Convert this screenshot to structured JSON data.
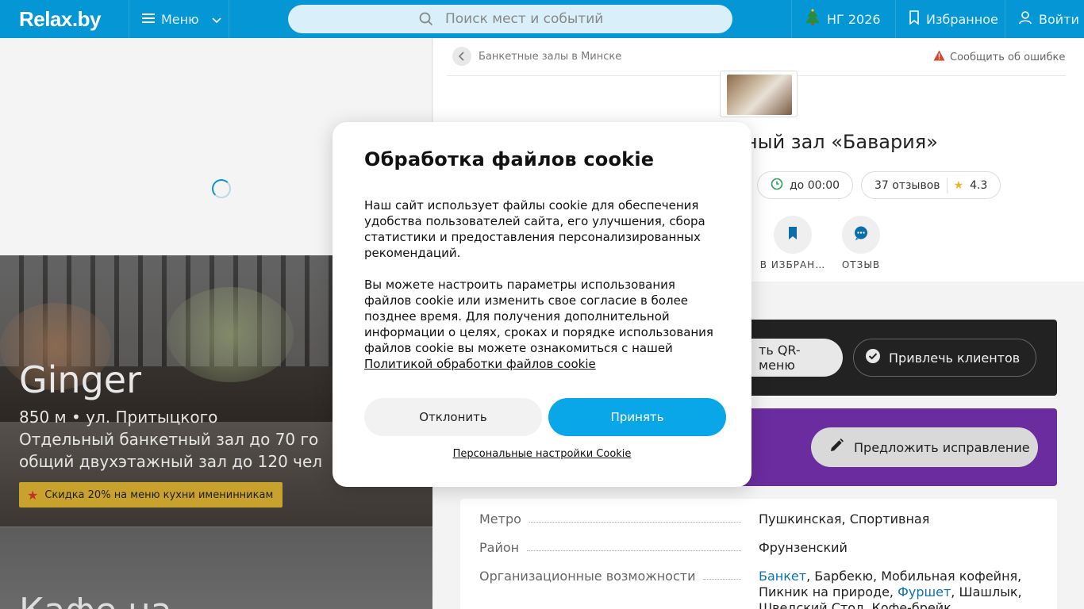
{
  "header": {
    "logo": "Relax.by",
    "menu_label": "Меню",
    "search_placeholder": "Поиск мест и событий",
    "ny_label": "НГ 2026",
    "favorites_label": "Избранное",
    "login_label": "Войти"
  },
  "listing": {
    "ginger": {
      "title": "Ginger",
      "line1": "850 м • ул. Притыцкого",
      "line2": "Отдельный банкетный зал до 70 го",
      "line3": "общий двухэтажный зал до 120 чел",
      "promo": "Скидка 20% на меню кухни именинникам"
    },
    "cafe": {
      "title": "Кафе на"
    }
  },
  "place": {
    "breadcrumb": "Банкетные залы в Минске",
    "report_error": "Сообщить об ошибке",
    "title": "нкетный зал «Бавария»",
    "hours": "до 00:00",
    "reviews": "37 отзывов",
    "rating": "4.3",
    "actions": [
      {
        "label": "В ИЗБРАН…"
      },
      {
        "label": "ОТЗЫВ"
      }
    ],
    "qr_menu_button": "ть QR-меню",
    "attract_clients_button": "Привлечь клиентов",
    "suggest_fix_button": "Предложить исправление",
    "info": [
      {
        "key": "Метро",
        "value": "Пушкинская, Спортивная"
      },
      {
        "key": "Район",
        "value": "Фрунзенский"
      },
      {
        "key": "Организационные возможности"
      }
    ],
    "org_options": {
      "link1": "Банкет",
      "text1": ", Барбекю, Мобильная кофейня,",
      "text2": "Пикник на природе, ",
      "link2": "Фуршет",
      "text3": ", Шашлык,",
      "text4": "Шведский Стол, Кофе-брейк"
    }
  },
  "cookie_modal": {
    "title": "Обработка файлов cookie",
    "para1": "Наш сайт использует файлы cookie для обеспечения удобства пользователей сайта, его улучшения, сбора статистики и предоставления персонализированных рекомендаций.",
    "para2": "Вы можете настроить параметры использования файлов cookie или изменить свое согласие в более позднее время. Для получения дополнительной информации о целях, сроках и порядке использования файлов cookie вы можете ознакомиться с нашей",
    "policy_link": "Политикой обработки файлов cookie",
    "decline": "Отклонить",
    "accept": "Принять",
    "personal_settings": "Персональные настройки Cookie"
  },
  "colors": {
    "brand": "#0596d6",
    "accept": "#0aa7e8",
    "promo": "#c8a22c",
    "purple_banner": "#6a2c9f"
  }
}
